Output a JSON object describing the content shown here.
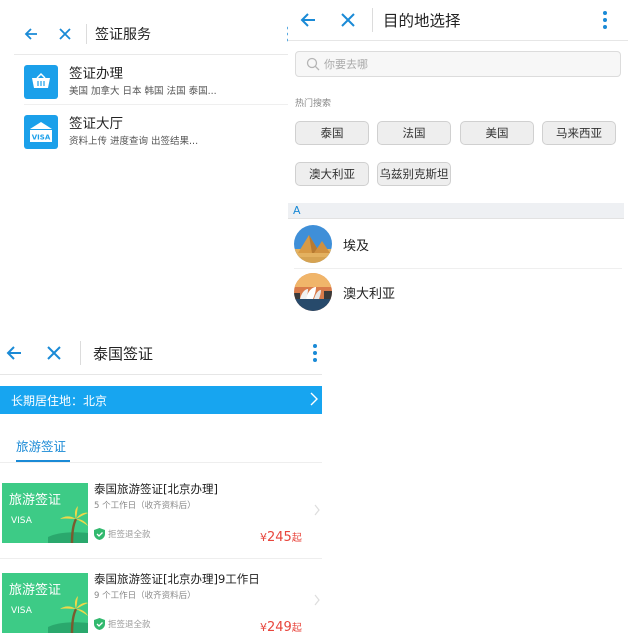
{
  "visa_service": {
    "title": "签证服务",
    "items": [
      {
        "name": "签证办理",
        "desc": "美国 加拿大 日本 韩国 法国 泰国..."
      },
      {
        "name": "签证大厅",
        "desc": "资料上传 进度查询 出签结果...",
        "icon_text": "VISA"
      }
    ]
  },
  "destination": {
    "title": "目的地选择",
    "search_placeholder": "你要去哪",
    "hot_label": "热门搜索",
    "hot": [
      "泰国",
      "法国",
      "美国",
      "马来西亚",
      "澳大利亚",
      "乌兹别克斯坦"
    ],
    "section": "A",
    "list": [
      {
        "name": "埃及",
        "icon": "pyramids-photo"
      },
      {
        "name": "澳大利亚",
        "icon": "sydney-opera-house-photo"
      }
    ]
  },
  "thailand": {
    "title": "泰国签证",
    "residence": "长期居住地：北京",
    "tab": "旅游签证",
    "thumb_text": "旅游签证",
    "thumb_sub": "VISA",
    "badge": "拒签退全款",
    "cards": [
      {
        "title": "泰国旅游签证[北京办理]",
        "sub": "5 个工作日（收齐资料后）",
        "currency": "¥",
        "price": "245",
        "unit": "起"
      },
      {
        "title": "泰国旅游签证[北京办理]9工作日",
        "sub": "9 个工作日（收齐资料后）",
        "currency": "¥",
        "price": "249",
        "unit": "起"
      }
    ]
  },
  "colors": {
    "accent": "#1a8ad6",
    "bar": "#17a5f0",
    "price": "#e8453c",
    "thumb": "#3dcb86"
  }
}
